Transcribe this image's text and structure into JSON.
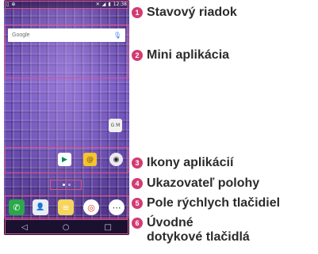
{
  "phone": {
    "status_bar": {
      "time": "12:38",
      "left_icons": [
        "notification-icon",
        "lg-icon"
      ],
      "right_icons": [
        "mute-icon",
        "signal-icon",
        "battery-icon"
      ]
    },
    "search_bar": {
      "logo": "Google",
      "mic_icon": "mic-icon"
    },
    "apps": [
      {
        "name": "play-store-icon",
        "glyph": "▶"
      },
      {
        "name": "email-icon",
        "glyph": "@"
      },
      {
        "name": "camera-icon",
        "glyph": "◉"
      }
    ],
    "folder": {
      "name": "google-folder-icon",
      "glyph": "G M"
    },
    "page_indicator": {
      "pages": 2,
      "current": 1
    },
    "dock": [
      {
        "name": "phone-icon",
        "glyph": "✆",
        "color": "#2aa84a"
      },
      {
        "name": "contacts-icon",
        "glyph": "👤",
        "color": "#e8edf3"
      },
      {
        "name": "messaging-icon",
        "glyph": "≡",
        "color": "#f6d55c"
      },
      {
        "name": "chrome-icon",
        "glyph": "◎",
        "color": "#ffffff"
      },
      {
        "name": "apps-icon",
        "glyph": "⋯",
        "color": "#ffffff"
      }
    ],
    "nav": {
      "back": "◁",
      "home": "○",
      "recent": "□"
    }
  },
  "callouts": [
    {
      "number": "1",
      "label": "Stavový riadok"
    },
    {
      "number": "2",
      "label": "Mini aplikácia"
    },
    {
      "number": "3",
      "label": "Ikony aplikácií"
    },
    {
      "number": "4",
      "label": "Ukazovateľ polohy"
    },
    {
      "number": "5",
      "label": "Pole rýchlych tlačidiel"
    },
    {
      "number": "6",
      "label": "Úvodné dotykové tlačidlá"
    }
  ],
  "accent_color": "#d23c72"
}
